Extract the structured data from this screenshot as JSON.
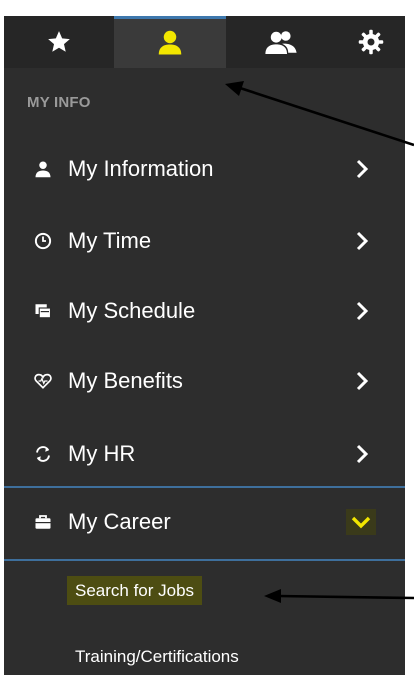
{
  "tabs": [
    {
      "icon": "star-icon",
      "active": false
    },
    {
      "icon": "user-icon",
      "active": true
    },
    {
      "icon": "users-icon",
      "active": false
    },
    {
      "icon": "gear-icon",
      "active": false
    }
  ],
  "section_title": "MY INFO",
  "menu": [
    {
      "label": "My Information",
      "icon": "person-icon"
    },
    {
      "label": "My Time",
      "icon": "clock-icon"
    },
    {
      "label": "My Schedule",
      "icon": "calendar-icon"
    },
    {
      "label": "My Benefits",
      "icon": "heart-icon"
    },
    {
      "label": "My HR",
      "icon": "refresh-icon"
    }
  ],
  "career": {
    "label": "My Career",
    "icon": "briefcase-icon",
    "expanded": true
  },
  "submenu": [
    {
      "label": "Search for Jobs",
      "highlighted": true
    },
    {
      "label": "Training/Certifications",
      "highlighted": false
    }
  ],
  "colors": {
    "accent": "#3e78ad",
    "highlight": "#e5e500",
    "bg": "#2d2d2d"
  }
}
